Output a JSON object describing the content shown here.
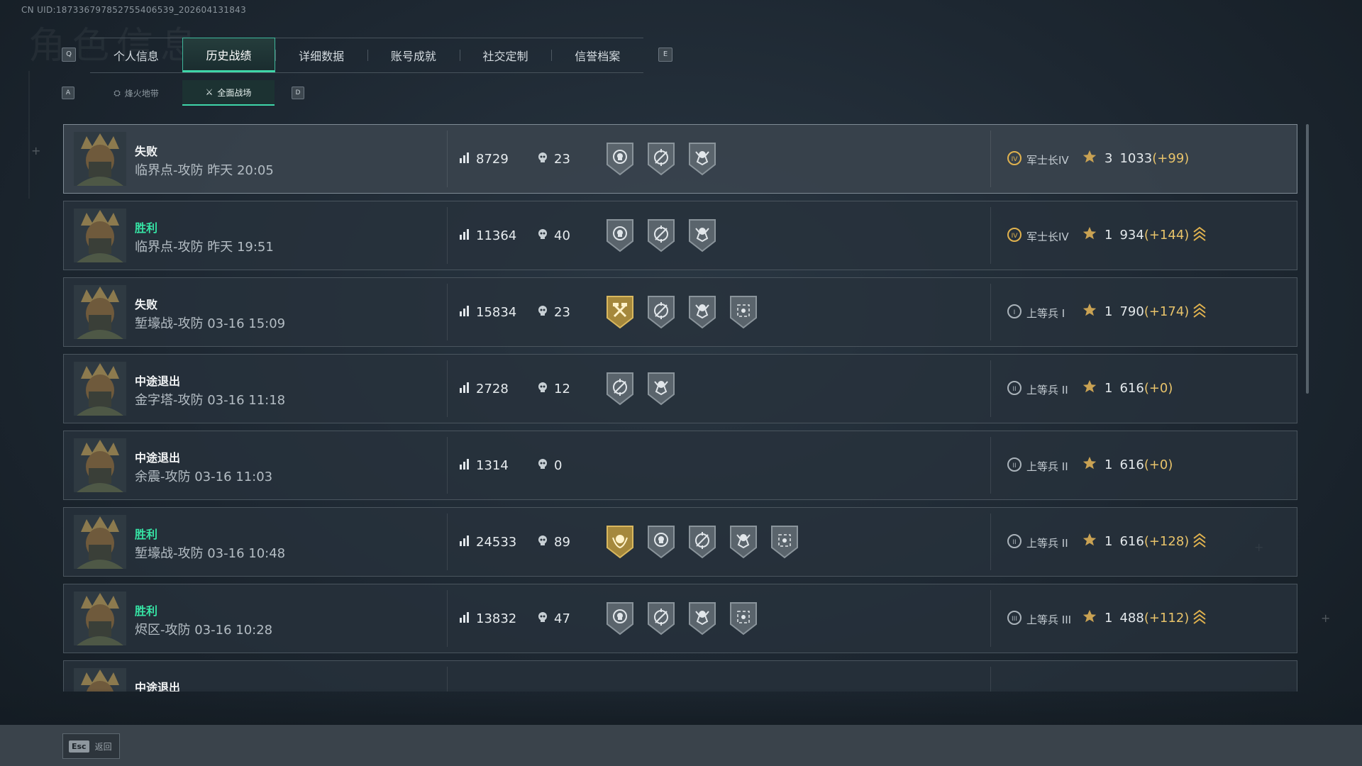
{
  "uid": "CN UID:18733679785275540653​9_202604131843",
  "keys": {
    "left_tab": "Q",
    "right_tab": "E",
    "left_sub": "A",
    "right_sub": "D"
  },
  "tabs": [
    {
      "label": "个人信息",
      "active": false
    },
    {
      "label": "历史战绩",
      "active": true
    },
    {
      "label": "详细数据",
      "active": false
    },
    {
      "label": "账号成就",
      "active": false
    },
    {
      "label": "社交定制",
      "active": false
    },
    {
      "label": "信誉档案",
      "active": false
    }
  ],
  "subtabs": [
    {
      "label": "烽火地带",
      "active": false
    },
    {
      "label": "全面战场",
      "active": true
    }
  ],
  "matches": [
    {
      "result": "失败",
      "win": false,
      "map": "临界点-攻防",
      "time": "昨天 20:05",
      "score": "8729",
      "kills": "23",
      "badges": [
        "skull-badge",
        "crosshair-badge",
        "reaper-badge"
      ],
      "rank_icon": "IV",
      "rank": "军士长IV",
      "rank_gold": true,
      "stars": "3",
      "points": "1033",
      "delta": "(+99)",
      "promo": false
    },
    {
      "result": "胜利",
      "win": true,
      "map": "临界点-攻防",
      "time": "昨天 19:51",
      "score": "11364",
      "kills": "40",
      "badges": [
        "skull-badge",
        "crosshair-badge",
        "reaper-badge"
      ],
      "rank_icon": "IV",
      "rank": "军士长IV",
      "rank_gold": true,
      "stars": "1",
      "points": "934",
      "delta": "(+144)",
      "promo": true
    },
    {
      "result": "失败",
      "win": false,
      "map": "堑壕战-攻防",
      "time": "03-16 15:09",
      "score": "15834",
      "kills": "23",
      "badges": [
        "gold-hammer-badge",
        "crosshair-badge",
        "reaper-badge",
        "scope-badge"
      ],
      "rank_icon": "I",
      "rank": "上等兵 I",
      "rank_gold": false,
      "stars": "1",
      "points": "790",
      "delta": "(+174)",
      "promo": true
    },
    {
      "result": "中途退出",
      "win": false,
      "map": "金字塔-攻防",
      "time": "03-16 11:18",
      "score": "2728",
      "kills": "12",
      "badges": [
        "crosshair-badge",
        "reaper-badge"
      ],
      "rank_icon": "II",
      "rank": "上等兵 II",
      "rank_gold": false,
      "stars": "1",
      "points": "616",
      "delta": "(+0)",
      "promo": false
    },
    {
      "result": "中途退出",
      "win": false,
      "map": "余震-攻防",
      "time": "03-16 11:03",
      "score": "1314",
      "kills": "0",
      "badges": [],
      "rank_icon": "II",
      "rank": "上等兵 II",
      "rank_gold": false,
      "stars": "1",
      "points": "616",
      "delta": "(+0)",
      "promo": false
    },
    {
      "result": "胜利",
      "win": true,
      "map": "堑壕战-攻防",
      "time": "03-16 10:48",
      "score": "24533",
      "kills": "89",
      "badges": [
        "gold-laurel-badge",
        "skull-badge",
        "crosshair-badge",
        "reaper-badge",
        "scope-badge"
      ],
      "rank_icon": "II",
      "rank": "上等兵 II",
      "rank_gold": false,
      "stars": "1",
      "points": "616",
      "delta": "(+128)",
      "promo": true
    },
    {
      "result": "胜利",
      "win": true,
      "map": "烬区-攻防",
      "time": "03-16 10:28",
      "score": "13832",
      "kills": "47",
      "badges": [
        "skull-badge",
        "crosshair-badge",
        "reaper-badge",
        "scope-badge"
      ],
      "rank_icon": "III",
      "rank": "上等兵 III",
      "rank_gold": false,
      "stars": "1",
      "points": "488",
      "delta": "(+112)",
      "promo": true
    },
    {
      "result": "中途退出",
      "win": false,
      "map": "",
      "time": "",
      "score": "",
      "kills": "",
      "badges": [],
      "rank_icon": "",
      "rank": "",
      "rank_gold": false,
      "stars": "",
      "points": "",
      "delta": "",
      "promo": false
    }
  ],
  "footer": {
    "esc_key": "Esc",
    "esc_label": "返回"
  },
  "colors": {
    "accent": "#3fd6a9",
    "win": "#36e3a4",
    "gold": "#e8c36a",
    "panel": "#28323c"
  }
}
